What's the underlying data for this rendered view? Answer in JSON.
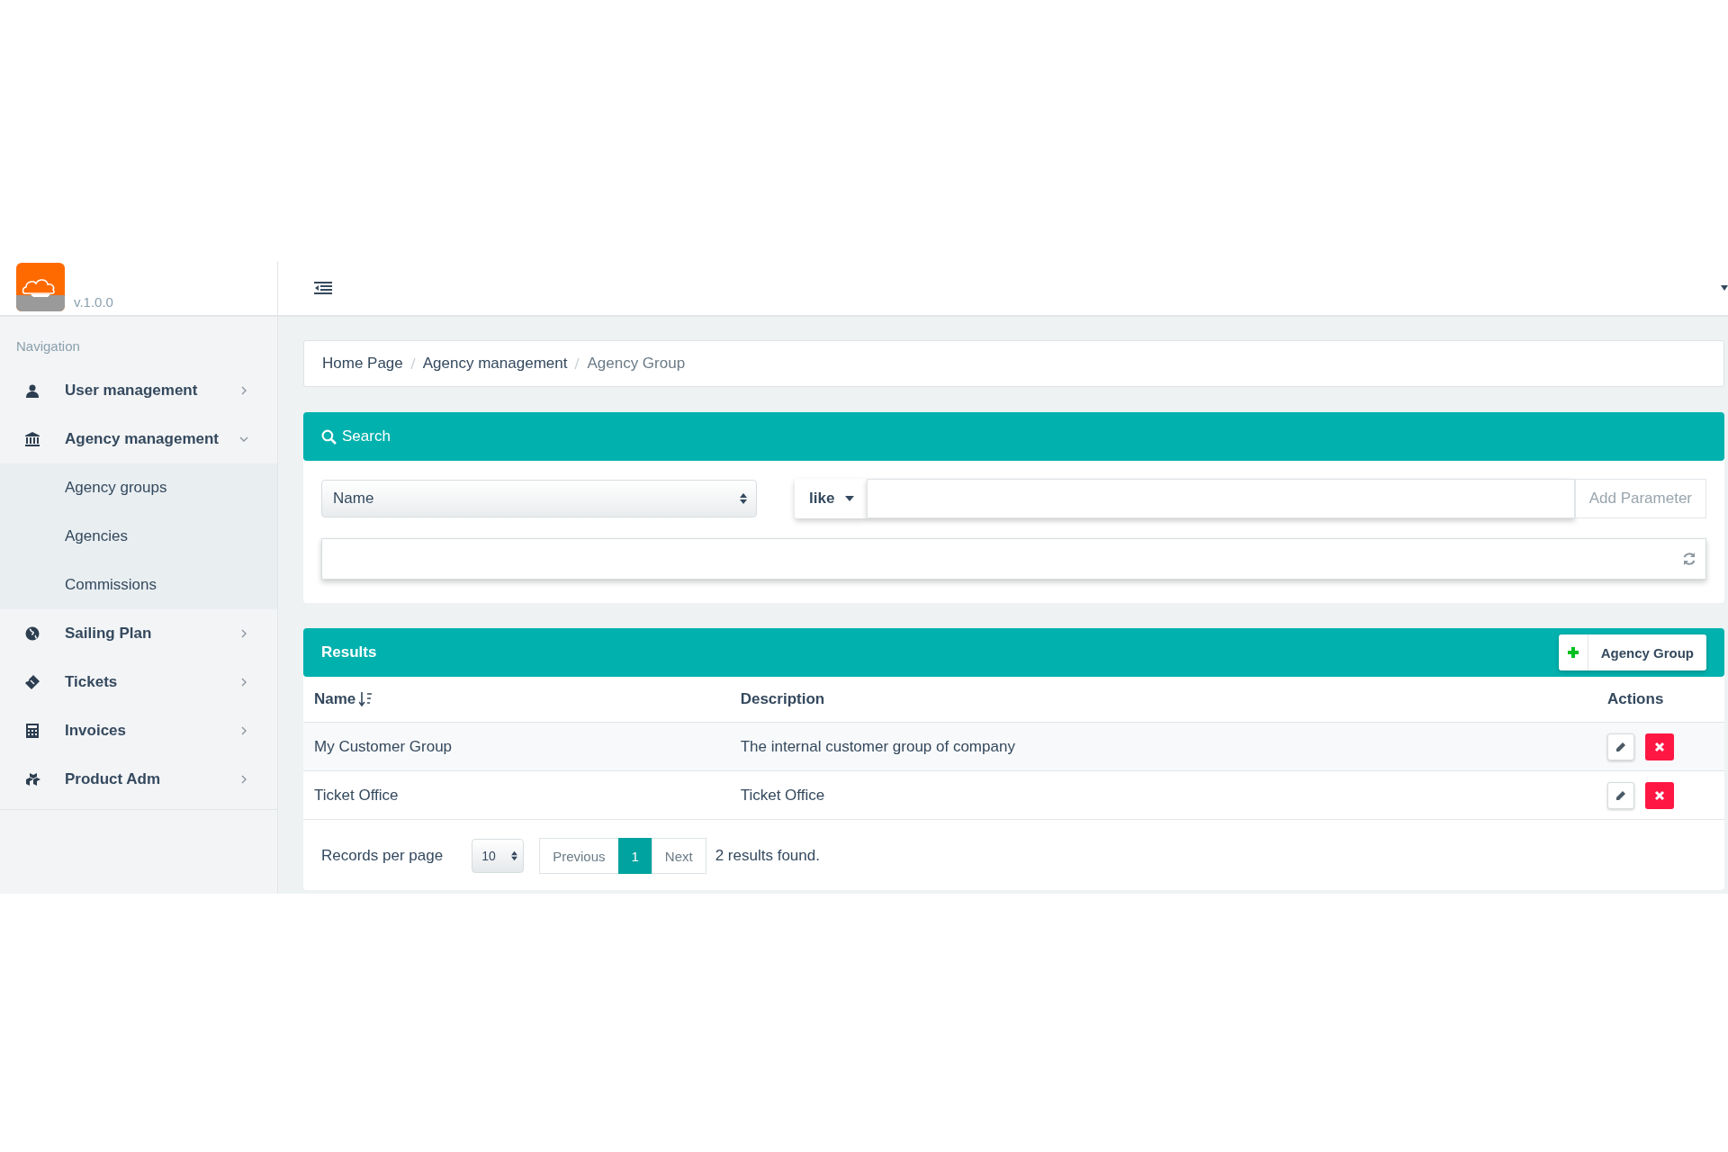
{
  "brand": {
    "version": "v.1.0.0"
  },
  "sidebar": {
    "heading": "Navigation",
    "items": [
      {
        "label": "User management",
        "expanded": false
      },
      {
        "label": "Agency management",
        "expanded": true,
        "children": [
          {
            "label": "Agency groups",
            "selected": false
          },
          {
            "label": "Agencies",
            "selected": false
          },
          {
            "label": "Commissions",
            "selected": false
          }
        ]
      },
      {
        "label": "Sailing Plan",
        "expanded": false
      },
      {
        "label": "Tickets",
        "expanded": false
      },
      {
        "label": "Invoices",
        "expanded": false
      },
      {
        "label": "Product Adm",
        "expanded": false
      }
    ]
  },
  "breadcrumb": [
    "Home Page",
    "Agency management",
    "Agency Group"
  ],
  "search": {
    "title": "Search",
    "field": "Name",
    "operator": "like",
    "add_button": "Add Parameter"
  },
  "results": {
    "title": "Results",
    "add_button": "Agency Group",
    "columns": [
      "Name",
      "Description",
      "Actions"
    ],
    "rows": [
      {
        "name": "My Customer Group",
        "description": "The internal customer group of company"
      },
      {
        "name": "Ticket Office",
        "description": "Ticket Office"
      }
    ],
    "per_page_label": "Records per page",
    "per_page": "10",
    "previous": "Previous",
    "pages": [
      {
        "label": "1",
        "selected": true
      }
    ],
    "next": "Next",
    "summary": "2 results found."
  }
}
